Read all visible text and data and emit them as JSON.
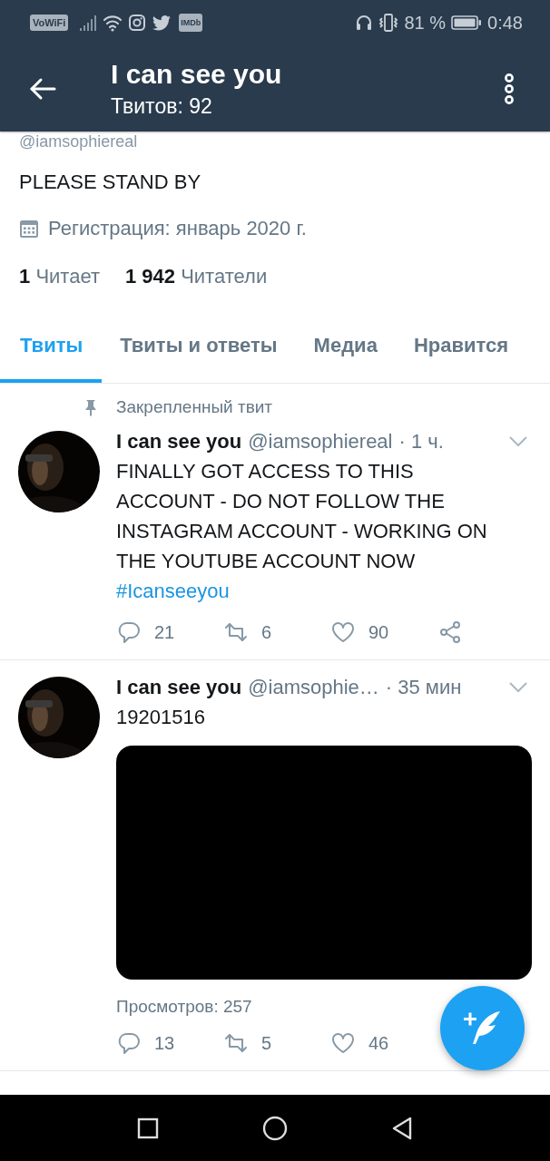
{
  "status_bar": {
    "badges": [
      "VoWiFi",
      "IMDb"
    ],
    "battery": "81 %",
    "time": "0:48"
  },
  "header": {
    "title": "I can see you",
    "subtitle": "Твитов: 92"
  },
  "profile": {
    "handle": "@iamsophiereal",
    "bio": "PLEASE STAND BY",
    "joined": "Регистрация: январь 2020 г.",
    "stats": [
      {
        "count": "1",
        "label": "Читает"
      },
      {
        "count": "1 942",
        "label": "Читатели"
      }
    ]
  },
  "tabs": [
    {
      "label": "Твиты",
      "selected": true
    },
    {
      "label": "Твиты и ответы",
      "selected": false
    },
    {
      "label": "Медиа",
      "selected": false
    },
    {
      "label": "Нравится",
      "selected": false
    }
  ],
  "tweets": [
    {
      "pinned": "Закрепленный твит",
      "name": "I can see you",
      "handle": "@iamsophiereal",
      "time": "· 1 ч.",
      "text": "FINALLY GOT ACCESS TO THIS ACCOUNT - DO NOT FOLLOW THE INSTAGRAM ACCOUNT - WORKING ON THE YOUTUBE ACCOUNT NOW",
      "hashtag": "#Icanseeyou",
      "replies": "21",
      "retweets": "6",
      "likes": "90",
      "share": true
    },
    {
      "name": "I can see you",
      "handle": "@iamsophie…",
      "time": "· 35 мин",
      "text": "19201516",
      "media": {
        "kind": "video"
      },
      "views": "Просмотров: 257",
      "replies": "13",
      "retweets": "5",
      "likes": "46",
      "share": false
    }
  ]
}
